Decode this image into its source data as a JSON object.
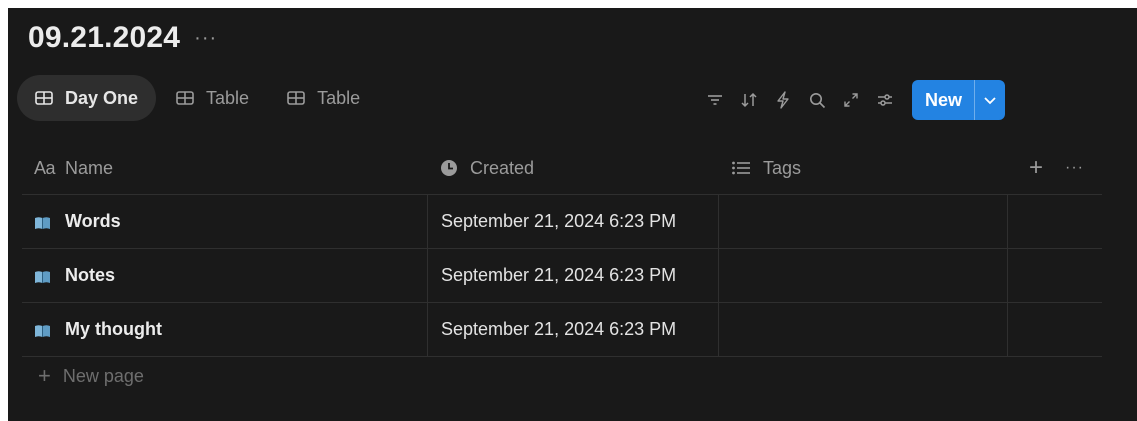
{
  "database": {
    "title": "09.21.2024",
    "more": "···"
  },
  "views": [
    {
      "label": "Day One",
      "icon": "table-icon",
      "active": true
    },
    {
      "label": "Table",
      "icon": "table-icon",
      "active": false
    },
    {
      "label": "Table",
      "icon": "table-icon",
      "active": false
    }
  ],
  "toolbar": {
    "icons": [
      "filter-icon",
      "sort-icon",
      "automation-icon",
      "search-icon",
      "expand-icon",
      "settings-icon"
    ],
    "new_label": "New",
    "accent": "#2383e2"
  },
  "columns": {
    "name": {
      "label": "Name",
      "icon": "text-type-icon",
      "icon_text": "Aa"
    },
    "created": {
      "label": "Created",
      "icon": "clock-icon"
    },
    "tags": {
      "label": "Tags",
      "icon": "list-icon"
    },
    "add": "+",
    "more": "···"
  },
  "rows": [
    {
      "name": "Words",
      "created": "September 21, 2024 6:23 PM",
      "tags": ""
    },
    {
      "name": "Notes",
      "created": "September 21, 2024 6:23 PM",
      "tags": ""
    },
    {
      "name": "My thought",
      "created": "September 21, 2024 6:23 PM",
      "tags": ""
    }
  ],
  "new_page": {
    "label": "New page",
    "icon": "+"
  }
}
